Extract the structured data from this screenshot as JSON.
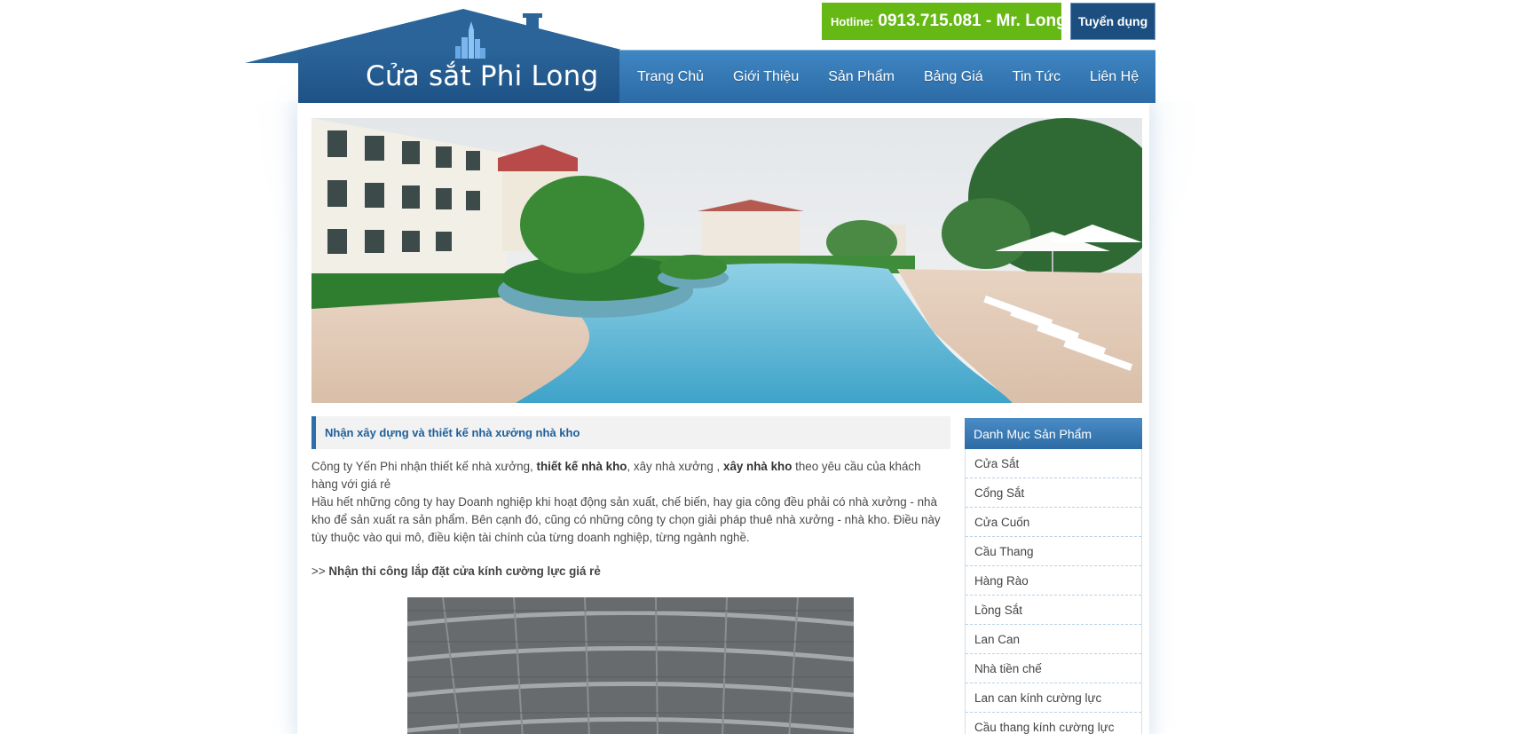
{
  "header": {
    "logo_text": "Cửa sắt Phi Long",
    "hotline_label": "Hotline:",
    "hotline_number": "0913.715.081 - Mr. Long",
    "recruit_label": "Tuyển dụng"
  },
  "nav": {
    "items": [
      {
        "label": "Trang Chủ"
      },
      {
        "label": "Giới Thiệu"
      },
      {
        "label": "Sản Phẩm"
      },
      {
        "label": "Bảng Giá"
      },
      {
        "label": "Tin Tức"
      },
      {
        "label": "Liên Hệ"
      }
    ]
  },
  "article": {
    "title": "Nhận xây dựng và thiết kế nhà xưởng nhà kho",
    "p1_a": "Công ty Yến Phi nhận thiết kế nhà xưởng, ",
    "p1_b": "thiết kế nhà kho",
    "p1_c": ", xây nhà xưởng , ",
    "p1_d": "xây nhà kho",
    "p1_e": " theo yêu cầu của khách hàng với giá rẻ",
    "p2": "Hầu hết những công ty hay Doanh nghiệp khi hoạt động sản xuất, chế biến, hay gia công đều phải có nhà xưởng - nhà kho để sản xuất ra sản phẩm. Bên cạnh đó, cũng có những công ty chọn giải pháp thuê nhà xưởng - nhà kho. Điều này tùy thuộc vào qui mô, điều kiện tài chính của từng doanh nghiệp, từng ngành nghề.",
    "link_prefix": ">> ",
    "link_text": "Nhận thi công lắp đặt cửa kính cường lực giá rẻ"
  },
  "sidebar": {
    "title": "Danh Mục Sản Phẩm",
    "items": [
      {
        "label": "Cửa Sắt"
      },
      {
        "label": "Cổng Sắt"
      },
      {
        "label": "Cửa Cuốn"
      },
      {
        "label": "Cầu Thang"
      },
      {
        "label": "Hàng Rào"
      },
      {
        "label": "Lồng Sắt"
      },
      {
        "label": "Lan Can"
      },
      {
        "label": "Nhà tiền chế"
      },
      {
        "label": "Lan can kính cường lực"
      },
      {
        "label": "Cầu thang kính cường lực"
      }
    ]
  },
  "colors": {
    "brand_blue": "#2b6ba6",
    "hotline_green": "#66b814",
    "recruit_navy": "#1c4f80"
  },
  "icons": {
    "roof": "house-roof-icon",
    "city": "city-skyline-icon",
    "chimney": "chimney-icon"
  }
}
